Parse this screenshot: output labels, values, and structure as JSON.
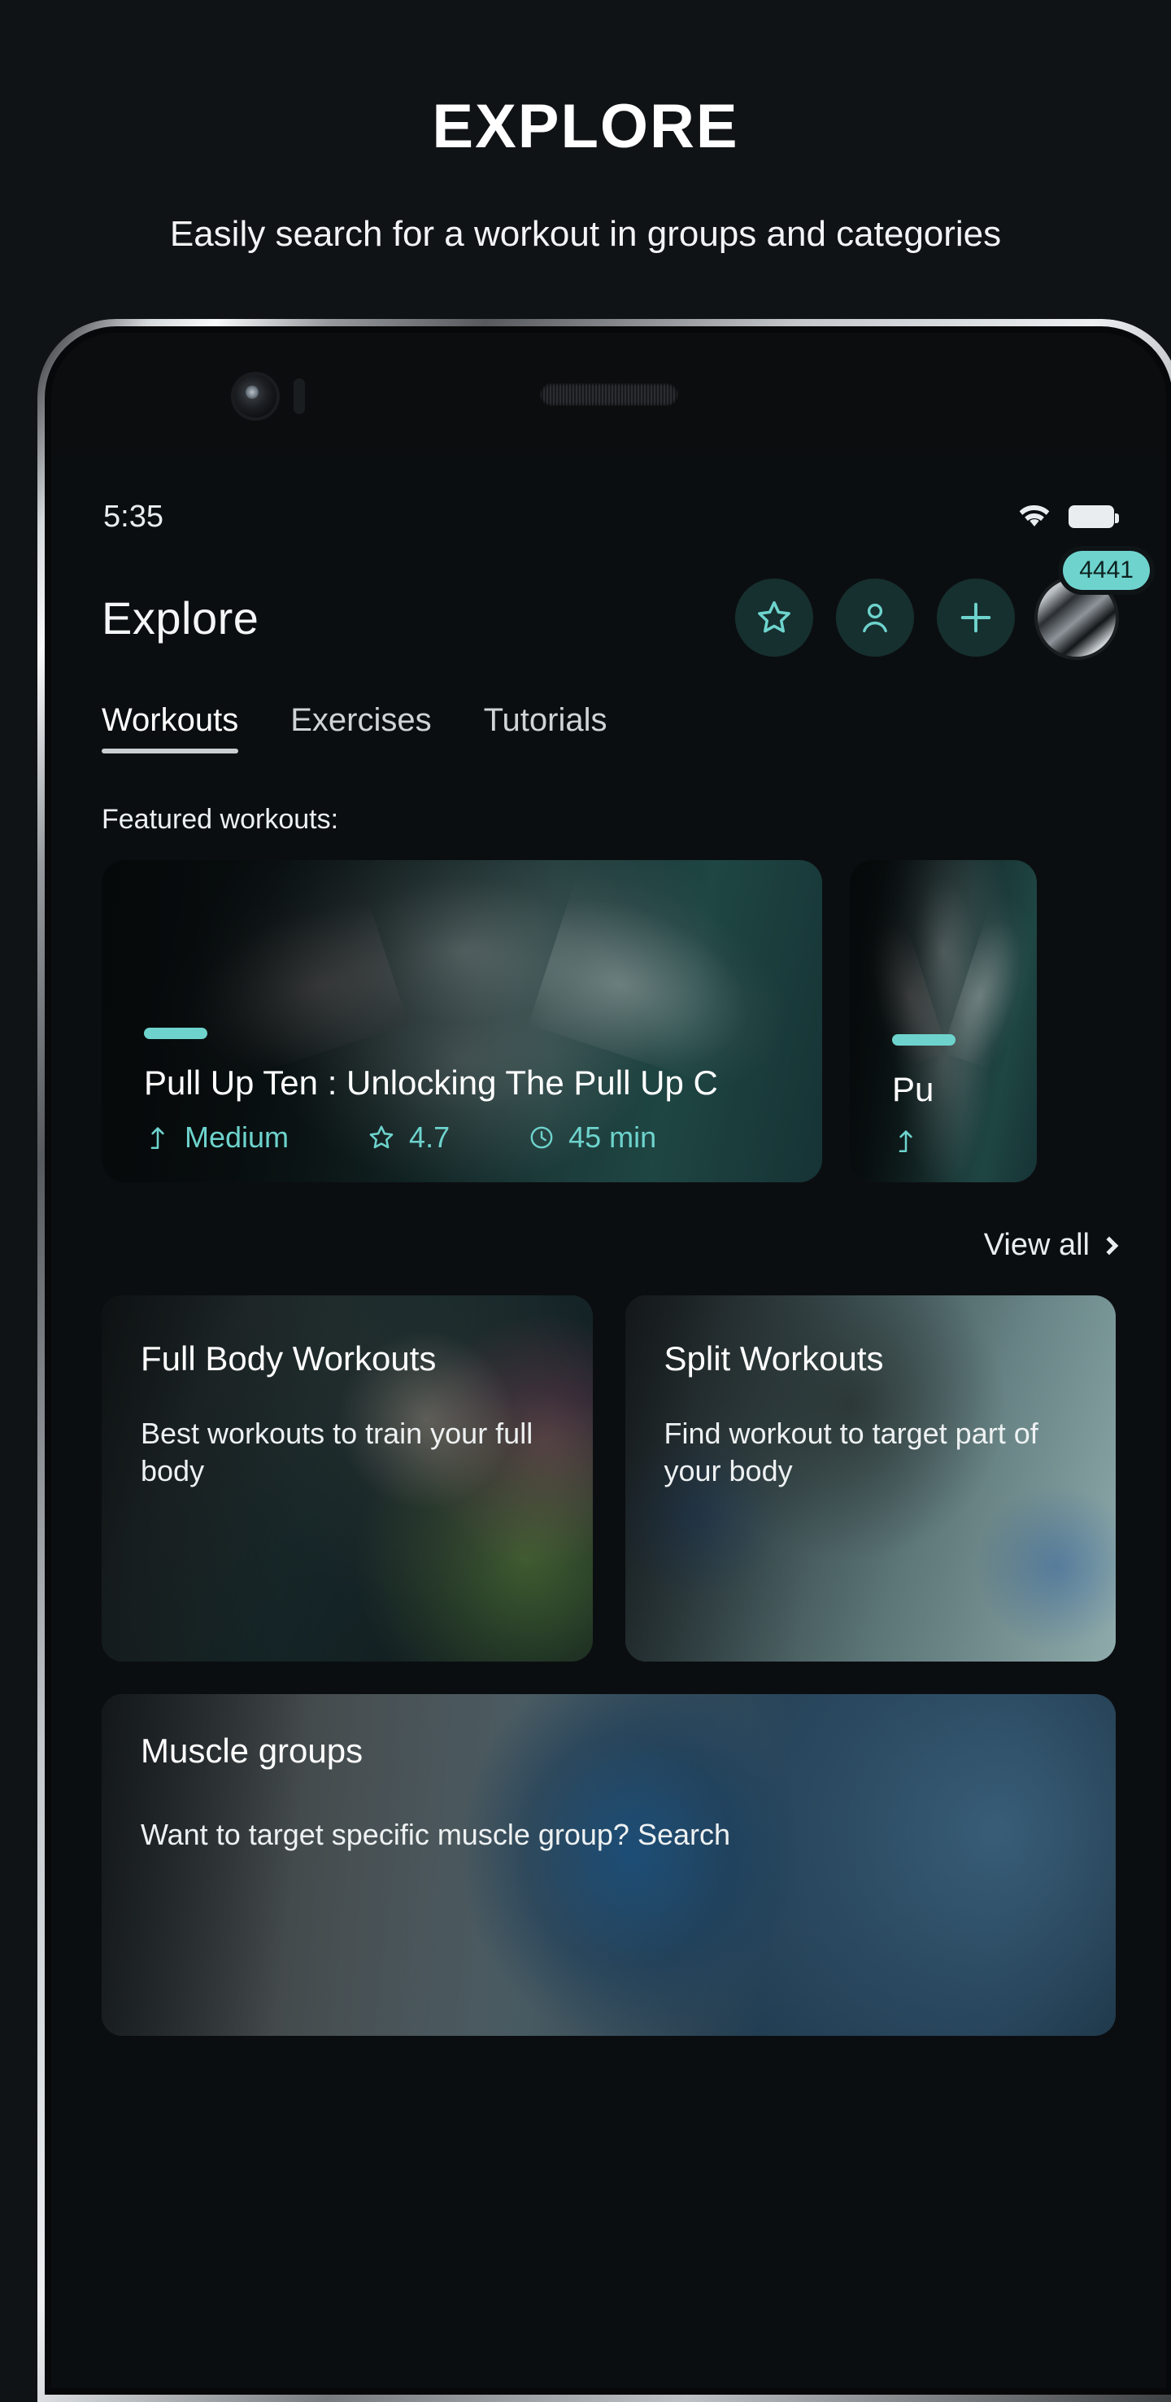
{
  "promo": {
    "title": "EXPLORE",
    "subtitle": "Easily search for a workout in groups and categories"
  },
  "colors": {
    "accent": "#6ed3cd",
    "background": "#101316",
    "screen_background": "#0b0e11",
    "text_primary": "#ffffff",
    "badge_bg": "#6ed3cd",
    "circle_button_bg": "#16302f"
  },
  "statusbar": {
    "time": "5:35",
    "wifi_icon": "wifi-icon",
    "battery_icon": "battery-icon"
  },
  "header": {
    "title": "Explore",
    "actions": [
      {
        "icon": "star-icon",
        "name": "favorites-button"
      },
      {
        "icon": "person-icon",
        "name": "profile-button"
      },
      {
        "icon": "plus-icon",
        "name": "add-button"
      }
    ],
    "avatar": {
      "icon": "avatar",
      "badge": "4441"
    }
  },
  "tabs": [
    {
      "label": "Workouts",
      "active": true
    },
    {
      "label": "Exercises",
      "active": false
    },
    {
      "label": "Tutorials",
      "active": false
    }
  ],
  "sections": {
    "featured_label": "Featured workouts:",
    "view_all": "View all"
  },
  "featured": [
    {
      "title": "Pull Up Ten : Unlocking The Pull Up C",
      "difficulty": "Medium",
      "difficulty_icon": "arrow-up-icon",
      "rating": "4.7",
      "rating_icon": "star-icon",
      "duration": "45 min",
      "duration_icon": "clock-icon"
    },
    {
      "title": "Pu",
      "difficulty": "",
      "difficulty_icon": "arrow-up-icon",
      "rating": "",
      "rating_icon": "star-icon",
      "duration": "",
      "duration_icon": "clock-icon"
    }
  ],
  "categories": [
    {
      "title": "Full Body Workouts",
      "description": "Best workouts to train your full body"
    },
    {
      "title": "Split Workouts",
      "description": "Find workout to target part of your body"
    }
  ],
  "wide_card": {
    "title": "Muscle groups",
    "description": "Want to target specific muscle group? Search"
  }
}
